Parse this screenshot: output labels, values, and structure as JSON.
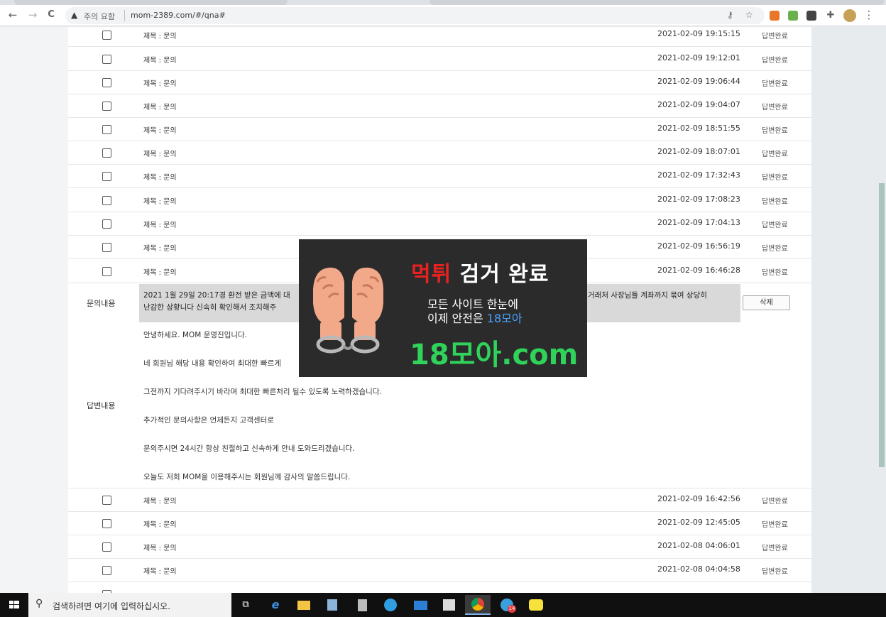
{
  "browser": {
    "security_warning": "주의 요함",
    "url": "mom-2389.com/#/qna#",
    "nav_back": "←",
    "nav_forward": "→",
    "nav_reload": "C"
  },
  "list": {
    "rows_before": [
      {
        "title": "제목 : 문의",
        "date": "2021-02-09 19:15:15",
        "status": "답변완료"
      },
      {
        "title": "제목 : 문의",
        "date": "2021-02-09 19:12:01",
        "status": "답변완료"
      },
      {
        "title": "제목 : 문의",
        "date": "2021-02-09 19:06:44",
        "status": "답변완료"
      },
      {
        "title": "제목 : 문의",
        "date": "2021-02-09 19:04:07",
        "status": "답변완료"
      },
      {
        "title": "제목 : 문의",
        "date": "2021-02-09 18:51:55",
        "status": "답변완료"
      },
      {
        "title": "제목 : 문의",
        "date": "2021-02-09 18:07:01",
        "status": "답변완료"
      },
      {
        "title": "제목 : 문의",
        "date": "2021-02-09 17:32:43",
        "status": "답변완료"
      },
      {
        "title": "제목 : 문의",
        "date": "2021-02-09 17:08:23",
        "status": "답변완료"
      },
      {
        "title": "제목 : 문의",
        "date": "2021-02-09 17:04:13",
        "status": "답변완료"
      },
      {
        "title": "제목 : 문의",
        "date": "2021-02-09 16:56:19",
        "status": "답변완료"
      },
      {
        "title": "제목 : 문의",
        "date": "2021-02-09 16:46:28",
        "status": "답변완료"
      }
    ],
    "rows_after": [
      {
        "title": "제목 : 문의",
        "date": "2021-02-09 16:42:56",
        "status": "답변완료"
      },
      {
        "title": "제목 : 문의",
        "date": "2021-02-09 12:45:05",
        "status": "답변완료"
      },
      {
        "title": "제목 : 문의",
        "date": "2021-02-08 04:06:01",
        "status": "답변완료"
      },
      {
        "title": "제목 : 문의",
        "date": "2021-02-08 04:04:58",
        "status": "답변완료"
      }
    ]
  },
  "question": {
    "label": "문의내용",
    "text_line1": "2021 1월 29일 20:17경 환전 받은 금액에 대",
    "text_line1_right": "거래처 사장님들 계좌까지 묶여 상당히",
    "text_line2": "난감한 상황니다 신속히 확인해서 조치해주",
    "delete_label": "삭제"
  },
  "answer": {
    "label": "답변내용",
    "lines": [
      "안녕하세요. MOM 운영진입니다.",
      "네 회원님 해당 내용 확인하여 최대한 빠르게",
      "그전까지 기다려주시기 바라며 최대한 빠른처리 될수 있도록 노력하겠습니다.",
      "추가적인 문의사항은 언제든지 고객센터로",
      "문의주시면 24시간 항상 친절하고 신속하게 안내 도와드리겠습니다.",
      "오늘도 저희 MOM을 이용해주시는 회원님께 감사의 말씀드립니다."
    ]
  },
  "ad": {
    "title_red": "먹튀",
    "title_rest": " 검거 완료",
    "sub1": "모든 사이트 한눈에",
    "sub2_prefix": "이제 안전은 ",
    "sub2_blue": "18모아",
    "domain": "18모아.com",
    "colors": {
      "red": "#e82121",
      "green": "#2fd35a",
      "blue": "#4aa3ff",
      "bg": "#2b2b2b"
    }
  },
  "taskbar": {
    "search_placeholder": "검색하려면 여기에 입력하십시오.",
    "apps": [
      "task-view-icon",
      "ie-icon",
      "file-explorer-icon",
      "notepad-icon",
      "calculator-icon",
      "edge-icon",
      "mail-icon",
      "store-icon",
      "chrome-icon",
      "telegram-icon",
      "kakaotalk-icon"
    ],
    "telegram_badge": "14"
  }
}
